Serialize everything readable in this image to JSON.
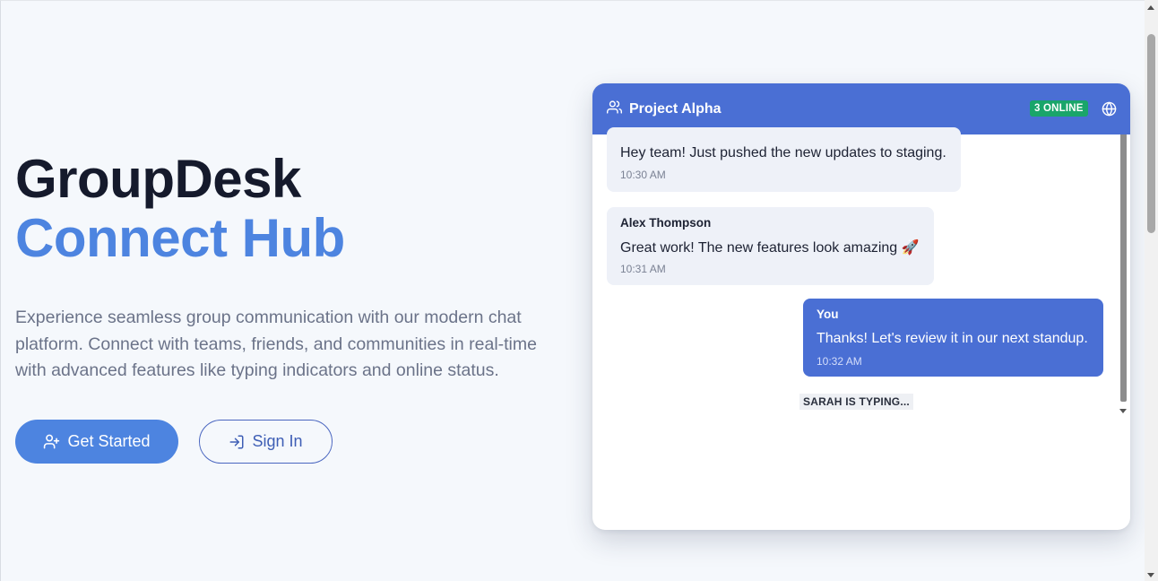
{
  "hero": {
    "title_line1": "GroupDesk",
    "title_line2": "Connect Hub",
    "description": "Experience seamless group communication with our modern chat platform. Connect with teams, friends, and communities in real-time with advanced features like typing indicators and online status.",
    "primary_button": {
      "label": "Get Started",
      "icon": "user-plus-icon"
    },
    "secondary_button": {
      "label": "Sign In",
      "icon": "sign-in-icon"
    }
  },
  "chat": {
    "group_name": "Project Alpha",
    "online_badge": "3 ONLINE",
    "header_icons": [
      "users-icon",
      "globe-icon"
    ],
    "messages": [
      {
        "type": "received",
        "sender": "",
        "text": "Hey team! Just pushed the new updates to staging.",
        "time": "10:30 AM"
      },
      {
        "type": "received",
        "sender": "Alex Thompson",
        "text": "Great work! The new features look amazing 🚀",
        "time": "10:31 AM"
      },
      {
        "type": "sent",
        "sender": "You",
        "text": "Thanks! Let's review it in our next standup.",
        "time": "10:32 AM"
      }
    ],
    "typing_indicator": "SARAH IS TYPING..."
  },
  "colors": {
    "accent": "#4d84e0",
    "header": "#4a6fd4",
    "online": "#1aa56a",
    "title_dark": "#151a2c",
    "text_muted": "#6b7389"
  }
}
